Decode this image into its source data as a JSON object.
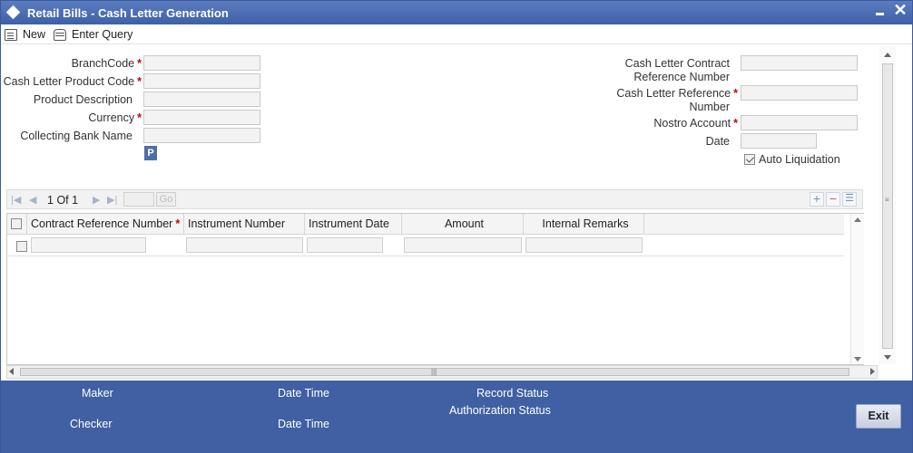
{
  "window": {
    "title": "Retail Bills - Cash Letter Generation",
    "close_glyph": "✕"
  },
  "toolbar": {
    "new_label": "New",
    "enter_query_label": "Enter Query"
  },
  "form": {
    "required_mark": "*",
    "branch_code_label": "BranchCode",
    "product_code_label": "Cash Letter Product Code",
    "product_description_label": "Product Description",
    "currency_label": "Currency",
    "collecting_bank_label": "Collecting Bank Name",
    "p_button_label": "P",
    "contract_ref_label_line1": "Cash Letter Contract",
    "contract_ref_label_line2": "Reference Number",
    "reference_label_line1": "Cash Letter Reference",
    "reference_label_line2": "Number",
    "nostro_label": "Nostro Account",
    "date_label": "Date",
    "auto_liquidation_label": "Auto Liquidation",
    "auto_liquidation_checked": true
  },
  "grid": {
    "page_current": "1",
    "page_of": "Of",
    "page_total": "1",
    "go_label": "Go",
    "columns": [
      "Contract Reference Number",
      "Instrument Number",
      "Instrument Date",
      "Amount",
      "Internal Remarks"
    ]
  },
  "footer": {
    "maker_label": "Maker",
    "date_time_label_1": "Date Time",
    "record_status_label": "Record Status",
    "checker_label": "Checker",
    "date_time_label_2": "Date Time",
    "authorization_status_label": "Authorization Status",
    "exit_label": "Exit"
  },
  "colors": {
    "titlebar": "#4a6db3",
    "footer": "#4060a3",
    "required": "#cc0000"
  }
}
